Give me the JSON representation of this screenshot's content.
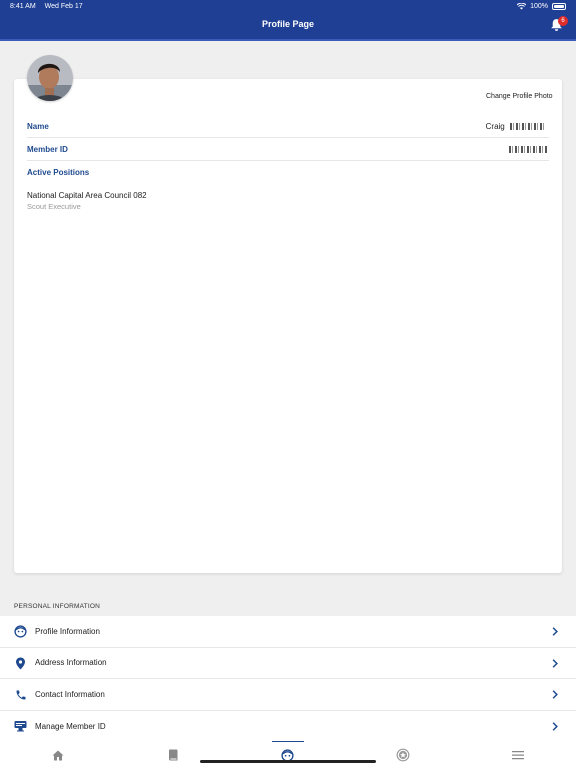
{
  "status_bar": {
    "time": "8:41 AM",
    "date": "Wed Feb 17",
    "battery": "100%"
  },
  "header": {
    "title": "Profile Page",
    "notification_count": "6"
  },
  "profile": {
    "change_photo_label": "Change Profile Photo",
    "name_label": "Name",
    "name_value": "Craig",
    "member_id_label": "Member ID",
    "positions_label": "Active Positions",
    "positions": [
      {
        "org": "National Capital Area Council 082",
        "role": "Scout Executive"
      }
    ]
  },
  "personal_info": {
    "section_title": "PERSONAL INFORMATION",
    "items": [
      {
        "label": "Profile Information",
        "icon": "face-icon"
      },
      {
        "label": "Address Information",
        "icon": "location-pin-icon"
      },
      {
        "label": "Contact Information",
        "icon": "phone-icon"
      },
      {
        "label": "Manage Member ID",
        "icon": "id-card-icon"
      }
    ]
  },
  "tab_bar": {
    "tabs": [
      {
        "icon": "home-icon",
        "active": false
      },
      {
        "icon": "book-icon",
        "active": false
      },
      {
        "icon": "profile-face-icon",
        "active": true
      },
      {
        "icon": "badge-icon",
        "active": false
      },
      {
        "icon": "menu-icon",
        "active": false
      }
    ]
  },
  "colors": {
    "header_bg": "#1f3f95",
    "accent": "#1f4a8f",
    "badge": "#e02b2b",
    "page_bg": "#efefef"
  }
}
